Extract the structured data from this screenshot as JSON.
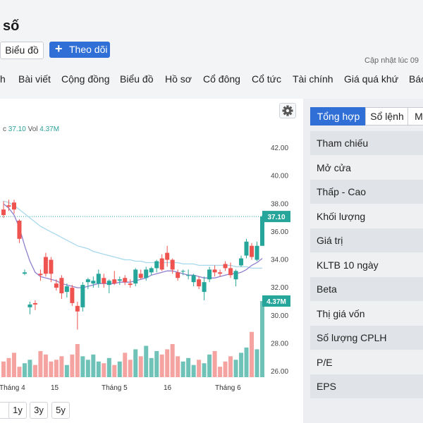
{
  "header": {
    "title": "số",
    "chart_button": "Biểu đồ",
    "follow_button": "Theo dõi",
    "updated_text": "Cập nhật lúc 09"
  },
  "nav": {
    "items": [
      "h",
      "Bài viết",
      "Cộng đồng",
      "Biểu đồ",
      "Hồ sơ",
      "Cổ đông",
      "Cổ tức",
      "Tài chính",
      "Giá quá khứ",
      "Báo"
    ]
  },
  "legend": {
    "prefix": "c",
    "close": "37.10",
    "vol_label": "Vol",
    "vol": "4.37M"
  },
  "ranges": [
    "1y",
    "3y",
    "5y"
  ],
  "panel": {
    "tabs": [
      "Tổng hợp",
      "Sổ lệnh",
      "M"
    ],
    "rows": [
      "Tham chiếu",
      "Mở cửa",
      "Thấp - Cao",
      "Khối lượng",
      "Giá trị",
      "KLTB 10 ngày",
      "Beta",
      "Thị giá vốn",
      "Số lượng CPLH",
      "P/E",
      "EPS"
    ]
  },
  "colors": {
    "up": "#26a69a",
    "down": "#ef5350",
    "vol_up": "#6fc2b7",
    "vol_down": "#f4a3a1",
    "ma_short": "#8f7fcf",
    "ma_long": "#a7d8ee",
    "accent": "#2f6fd6"
  },
  "icons": {
    "settings": "gear-icon",
    "follow": "plus-icon"
  },
  "chart_data": {
    "type": "candlestick",
    "y_ticks": [
      "42.00",
      "40.00",
      "38.00",
      "36.00",
      "34.00",
      "32.00",
      "30.00",
      "28.00",
      "26.00"
    ],
    "x_ticks": [
      "Tháng 4",
      "15",
      "Tháng 5",
      "16",
      "Tháng 6"
    ],
    "ylim": [
      26,
      42
    ],
    "last_price": 37.1,
    "last_price_label": "37.10",
    "last_volume_label": "4.37M",
    "candles": [
      {
        "o": 37.6,
        "h": 38.2,
        "l": 37.0,
        "c": 37.2
      },
      {
        "o": 37.9,
        "h": 38.3,
        "l": 37.5,
        "c": 37.8
      },
      {
        "o": 38.1,
        "h": 38.3,
        "l": 37.3,
        "c": 37.6
      },
      {
        "o": 36.8,
        "h": 36.9,
        "l": 35.2,
        "c": 35.5
      },
      {
        "o": 33.0,
        "h": 33.3,
        "l": 32.9,
        "c": 33.1
      },
      {
        "o": 30.6,
        "h": 31.0,
        "l": 30.1,
        "c": 30.8
      },
      {
        "o": 30.9,
        "h": 31.1,
        "l": 30.4,
        "c": 30.8
      },
      {
        "o": 33.0,
        "h": 33.3,
        "l": 32.5,
        "c": 32.9
      },
      {
        "o": 34.2,
        "h": 34.5,
        "l": 32.8,
        "c": 33.0
      },
      {
        "o": 34.0,
        "h": 34.2,
        "l": 32.4,
        "c": 33.0
      },
      {
        "o": 32.3,
        "h": 32.6,
        "l": 31.8,
        "c": 32.0
      },
      {
        "o": 32.7,
        "h": 32.9,
        "l": 31.2,
        "c": 31.6
      },
      {
        "o": 31.7,
        "h": 32.3,
        "l": 31.3,
        "c": 32.1
      },
      {
        "o": 32.0,
        "h": 32.2,
        "l": 30.7,
        "c": 30.9
      },
      {
        "o": 30.7,
        "h": 31.0,
        "l": 29.0,
        "c": 30.3
      },
      {
        "o": 30.6,
        "h": 32.4,
        "l": 30.3,
        "c": 32.2
      },
      {
        "o": 32.4,
        "h": 32.7,
        "l": 31.9,
        "c": 32.6
      },
      {
        "o": 32.3,
        "h": 32.8,
        "l": 32.0,
        "c": 32.5
      },
      {
        "o": 32.3,
        "h": 33.3,
        "l": 32.0,
        "c": 33.0
      },
      {
        "o": 32.7,
        "h": 33.0,
        "l": 32.0,
        "c": 32.3
      },
      {
        "o": 32.2,
        "h": 32.6,
        "l": 31.6,
        "c": 32.5
      },
      {
        "o": 32.6,
        "h": 33.2,
        "l": 32.2,
        "c": 32.3
      },
      {
        "o": 32.5,
        "h": 32.8,
        "l": 32.2,
        "c": 32.6
      },
      {
        "o": 32.7,
        "h": 32.9,
        "l": 32.2,
        "c": 32.4
      },
      {
        "o": 32.3,
        "h": 32.6,
        "l": 32.0,
        "c": 32.2
      },
      {
        "o": 32.3,
        "h": 33.4,
        "l": 32.1,
        "c": 33.3
      },
      {
        "o": 33.0,
        "h": 33.3,
        "l": 32.6,
        "c": 32.7
      },
      {
        "o": 32.7,
        "h": 33.5,
        "l": 32.5,
        "c": 33.3
      },
      {
        "o": 33.1,
        "h": 33.5,
        "l": 32.9,
        "c": 33.4
      },
      {
        "o": 33.4,
        "h": 34.0,
        "l": 33.1,
        "c": 33.9
      },
      {
        "o": 34.1,
        "h": 34.4,
        "l": 33.2,
        "c": 33.3
      },
      {
        "o": 34.5,
        "h": 35.0,
        "l": 33.5,
        "c": 34.0
      },
      {
        "o": 34.0,
        "h": 34.1,
        "l": 33.0,
        "c": 33.3
      },
      {
        "o": 33.1,
        "h": 33.3,
        "l": 32.5,
        "c": 32.7
      },
      {
        "o": 33.2,
        "h": 33.3,
        "l": 32.9,
        "c": 33.2
      },
      {
        "o": 32.9,
        "h": 33.3,
        "l": 32.6,
        "c": 32.9
      },
      {
        "o": 32.4,
        "h": 33.0,
        "l": 32.1,
        "c": 32.9
      },
      {
        "o": 32.6,
        "h": 32.8,
        "l": 31.9,
        "c": 32.1
      },
      {
        "o": 31.7,
        "h": 32.8,
        "l": 31.1,
        "c": 32.4
      },
      {
        "o": 32.6,
        "h": 33.5,
        "l": 32.4,
        "c": 33.3
      },
      {
        "o": 33.3,
        "h": 33.6,
        "l": 32.8,
        "c": 33.1
      },
      {
        "o": 33.1,
        "h": 33.3,
        "l": 32.8,
        "c": 33.0
      },
      {
        "o": 33.7,
        "h": 33.9,
        "l": 33.2,
        "c": 33.4
      },
      {
        "o": 33.4,
        "h": 33.8,
        "l": 32.7,
        "c": 32.9
      },
      {
        "o": 32.6,
        "h": 33.3,
        "l": 32.1,
        "c": 33.2
      },
      {
        "o": 33.6,
        "h": 34.3,
        "l": 33.5,
        "c": 34.1
      },
      {
        "o": 34.3,
        "h": 35.5,
        "l": 34.1,
        "c": 35.3
      },
      {
        "o": 35.0,
        "h": 35.2,
        "l": 34.0,
        "c": 34.2
      },
      {
        "o": 34.0,
        "h": 35.3,
        "l": 33.9,
        "c": 35.0
      },
      {
        "o": 35.0,
        "h": 37.2,
        "l": 35.0,
        "c": 37.1
      }
    ],
    "volumes_m": [
      0.9,
      1.1,
      1.4,
      0.6,
      0.8,
      1.0,
      0.7,
      1.5,
      1.3,
      0.9,
      1.0,
      1.2,
      0.7,
      1.3,
      1.9,
      1.2,
      1.0,
      1.3,
      0.9,
      0.8,
      1.1,
      0.7,
      0.9,
      1.4,
      1.0,
      1.6,
      1.2,
      1.8,
      1.1,
      1.5,
      1.3,
      1.6,
      1.9,
      1.2,
      0.9,
      1.1,
      0.7,
      1.0,
      0.8,
      1.3,
      1.5,
      0.6,
      0.9,
      1.2,
      1.0,
      1.4,
      1.7,
      2.6,
      1.6,
      4.37
    ],
    "ma_short": [
      38.0,
      37.7,
      37.2,
      36.3,
      35.0,
      33.9,
      33.1,
      32.8,
      32.7,
      32.6,
      32.5,
      32.3,
      32.2,
      32.1,
      32.0,
      32.0,
      32.1,
      32.2,
      32.3,
      32.3,
      32.3,
      32.3,
      32.4,
      32.4,
      32.4,
      32.5,
      32.6,
      32.7,
      32.9,
      33.0,
      33.1,
      33.2,
      33.2,
      33.1,
      33.0,
      32.9,
      32.9,
      32.8,
      32.7,
      32.7,
      32.7,
      32.8,
      32.9,
      33.0,
      33.0,
      33.1,
      33.3,
      33.6,
      33.8,
      34.1
    ],
    "ma_long": [
      38.2,
      38.1,
      37.9,
      37.6,
      37.3,
      37.0,
      36.7,
      36.4,
      36.2,
      36.0,
      35.8,
      35.6,
      35.4,
      35.2,
      35.0,
      34.9,
      34.8,
      34.6,
      34.5,
      34.4,
      34.3,
      34.2,
      34.1,
      34.0,
      34.0,
      33.9,
      33.9,
      33.8,
      33.8,
      33.8,
      33.8,
      33.8,
      33.8,
      33.8,
      33.7,
      33.7,
      33.7,
      33.6,
      33.6,
      33.6,
      33.6,
      33.6,
      33.6,
      33.6,
      33.5,
      33.5,
      33.5,
      33.4,
      33.4,
      33.4
    ]
  }
}
